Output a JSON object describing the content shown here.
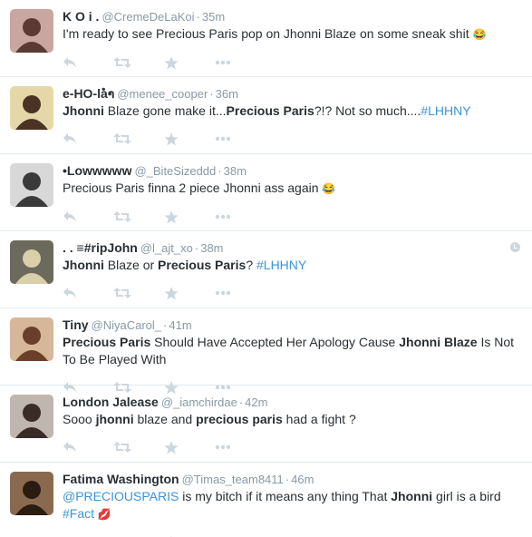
{
  "tweets": [
    {
      "name": "K O i .",
      "handle": "@CremeDeLaKoi",
      "time": "35m",
      "segments": [
        {
          "t": "I'm ready to see Precious Paris pop on Jhonni Blaze on some sneak shit "
        },
        {
          "t": "😂",
          "e": true
        }
      ],
      "avatar": {
        "bg": "#c9a7a0",
        "fg": "#5a3a33"
      }
    },
    {
      "name": "e-HO-laຳ",
      "handle": "@menee_cooper",
      "time": "36m",
      "segments": [
        {
          "t": "Jhonni",
          "b": true
        },
        {
          "t": " Blaze gone make it..."
        },
        {
          "t": "Precious Paris",
          "b": true
        },
        {
          "t": "?!? Not so much...."
        },
        {
          "t": "#LHHNY",
          "l": true
        }
      ],
      "avatar": {
        "bg": "#e6d7a8",
        "fg": "#4a3324"
      }
    },
    {
      "name": "•Lowwwww",
      "handle": "@_BiteSizeddd",
      "time": "38m",
      "segments": [
        {
          "t": "Precious Paris finna 2 piece Jhonni ass again "
        },
        {
          "t": "😂",
          "e": true
        }
      ],
      "avatar": {
        "bg": "#d8d8d8",
        "fg": "#3a3a3a"
      }
    },
    {
      "name": ". . ≡#ripJohn",
      "handle": "@l_ajt_xo",
      "time": "38m",
      "segments": [
        {
          "t": "Jhonni",
          "b": true
        },
        {
          "t": " Blaze or "
        },
        {
          "t": "Precious Paris",
          "b": true
        },
        {
          "t": "? "
        },
        {
          "t": "#LHHNY",
          "l": true
        }
      ],
      "avatar": {
        "bg": "#6b6a5c",
        "fg": "#d9cfa8"
      },
      "badge": true
    },
    {
      "name": "Tiny",
      "handle": "@NiyaCarol_",
      "time": "41m",
      "segments": [
        {
          "t": "Precious Paris",
          "b": true
        },
        {
          "t": " Should Have Accepted Her Apology Cause "
        },
        {
          "t": "Jhonni Blaze",
          "b": true
        },
        {
          "t": " Is Not To Be Played With"
        }
      ],
      "avatar": {
        "bg": "#d7b79a",
        "fg": "#6a3f2a"
      }
    },
    {
      "name": "London Jalease",
      "handle": "@_iamchirdae",
      "time": "42m",
      "segments": [
        {
          "t": "Sooo "
        },
        {
          "t": "jhonni",
          "b": true
        },
        {
          "t": " blaze and "
        },
        {
          "t": "precious paris",
          "b": true
        },
        {
          "t": " had a fight ?"
        }
      ],
      "avatar": {
        "bg": "#bfb6b0",
        "fg": "#3b2c27"
      }
    },
    {
      "name": "Fatima Washington",
      "handle": "@Timas_team8411",
      "time": "46m",
      "segments": [
        {
          "t": "@PRECIOUSPARIS",
          "l": true
        },
        {
          "t": " is my bitch  if it means any thing That "
        },
        {
          "t": "Jhonni",
          "b": true
        },
        {
          "t": " girl is a bird "
        },
        {
          "t": "#Fact",
          "l": true
        },
        {
          "t": " "
        },
        {
          "t": "💋",
          "e": true
        }
      ],
      "avatar": {
        "bg": "#8a6a4e",
        "fg": "#2b1c12"
      }
    }
  ],
  "icons": {
    "reply": "reply-icon",
    "retweet": "retweet-icon",
    "favorite": "favorite-icon",
    "more": "more-icon"
  },
  "colors": {
    "name": "#292f33",
    "meta": "#8899a6",
    "link": "#3b94d9",
    "action": "#ccd6dd"
  }
}
